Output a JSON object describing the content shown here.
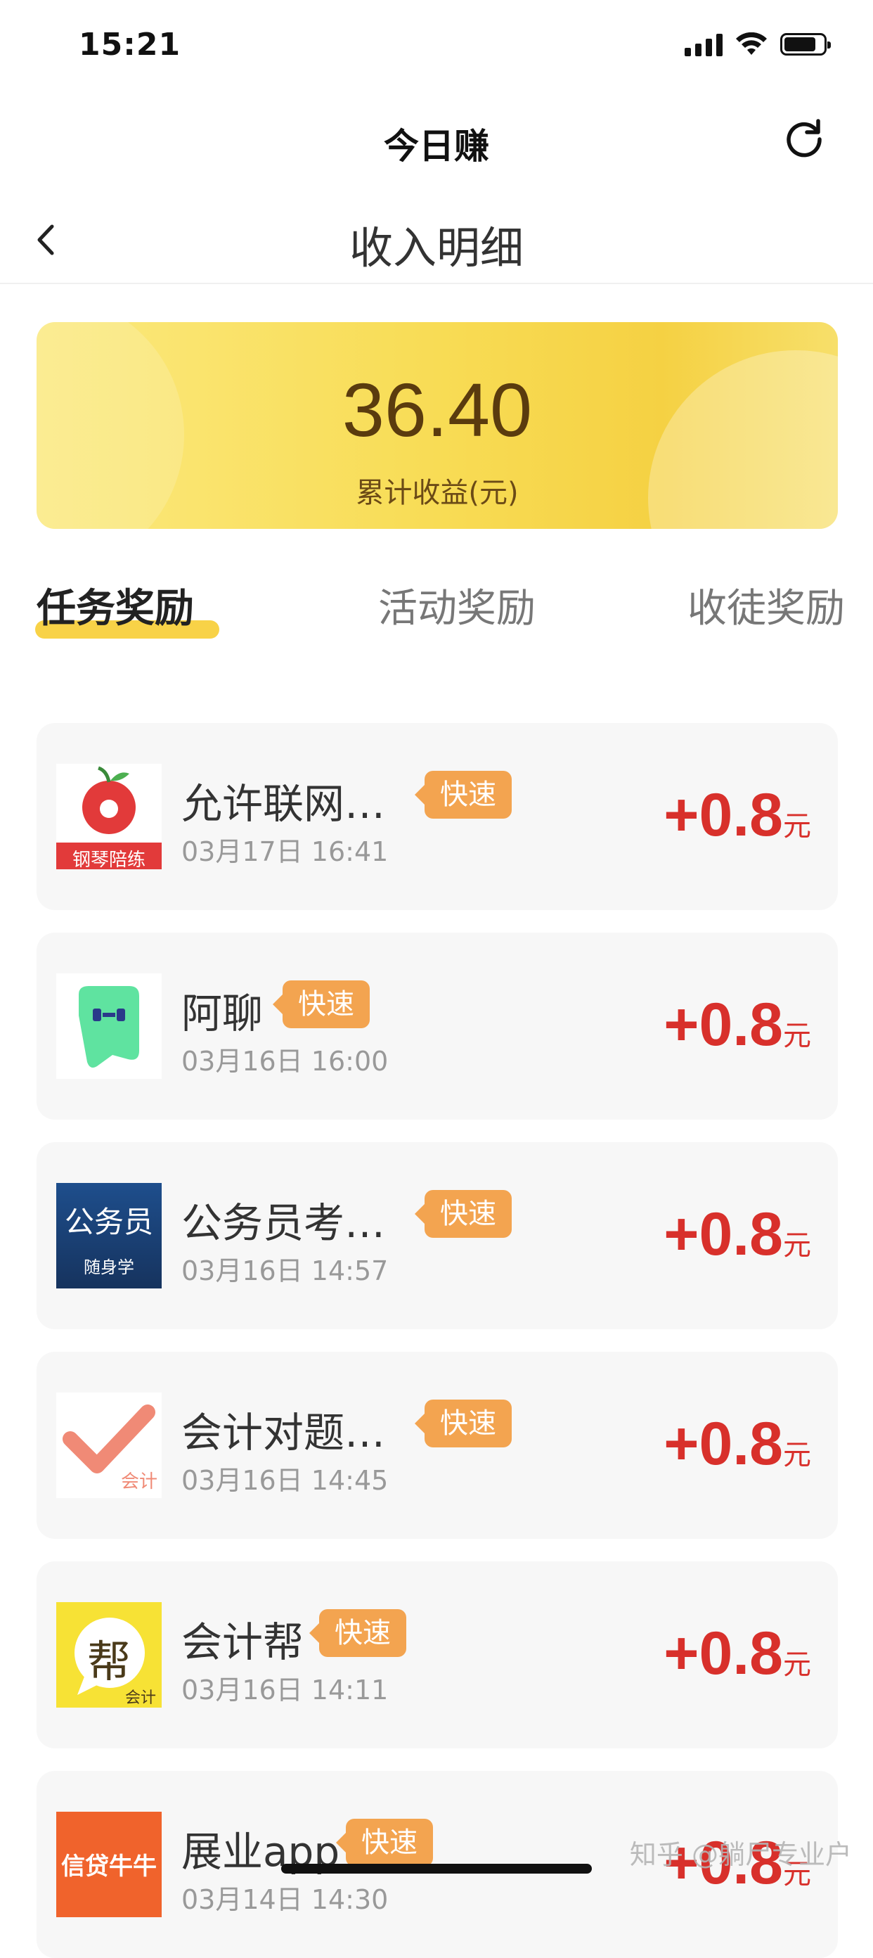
{
  "status_bar": {
    "time": "15:21"
  },
  "header": {
    "title": "今日赚"
  },
  "nav": {
    "title": "收入明细"
  },
  "summary": {
    "amount": "36.40",
    "label": "累计收益(元)"
  },
  "tabs": [
    {
      "label": "任务奖励",
      "active": true
    },
    {
      "label": "活动奖励",
      "active": false
    },
    {
      "label": "收徒奖励",
      "active": false
    }
  ],
  "items": [
    {
      "name": "允许联网…",
      "tag": "快速",
      "date": "03月17日 16:41",
      "amount": "+0.8",
      "unit": "元",
      "icon": "piano-app-icon",
      "icon_text": "钢琴陪练"
    },
    {
      "name": "阿聊",
      "tag": "快速",
      "date": "03月16日 16:00",
      "amount": "+0.8",
      "unit": "元",
      "icon": "chat-app-icon"
    },
    {
      "name": "公务员考…",
      "tag": "快速",
      "date": "03月16日 14:57",
      "amount": "+0.8",
      "unit": "元",
      "icon": "civil-service-app-icon",
      "icon_text": "公务员",
      "icon_subtext": "随身学"
    },
    {
      "name": "会计对题…",
      "tag": "快速",
      "date": "03月16日 14:45",
      "amount": "+0.8",
      "unit": "元",
      "icon": "accounting-check-app-icon",
      "icon_text": "会计"
    },
    {
      "name": "会计帮",
      "tag": "快速",
      "date": "03月16日 14:11",
      "amount": "+0.8",
      "unit": "元",
      "icon": "accounting-help-app-icon",
      "icon_text": "帮",
      "icon_subtext": "会计"
    },
    {
      "name": "展业app",
      "tag": "快速",
      "date": "03月14日 14:30",
      "amount": "+0.8",
      "unit": "元",
      "icon": "loan-app-icon",
      "icon_text": "信贷牛牛"
    }
  ],
  "watermark": "知乎 @躺尸专业户",
  "colors": {
    "accent": "#f8d247",
    "amount": "#d8302b",
    "tag": "#f3a450"
  }
}
